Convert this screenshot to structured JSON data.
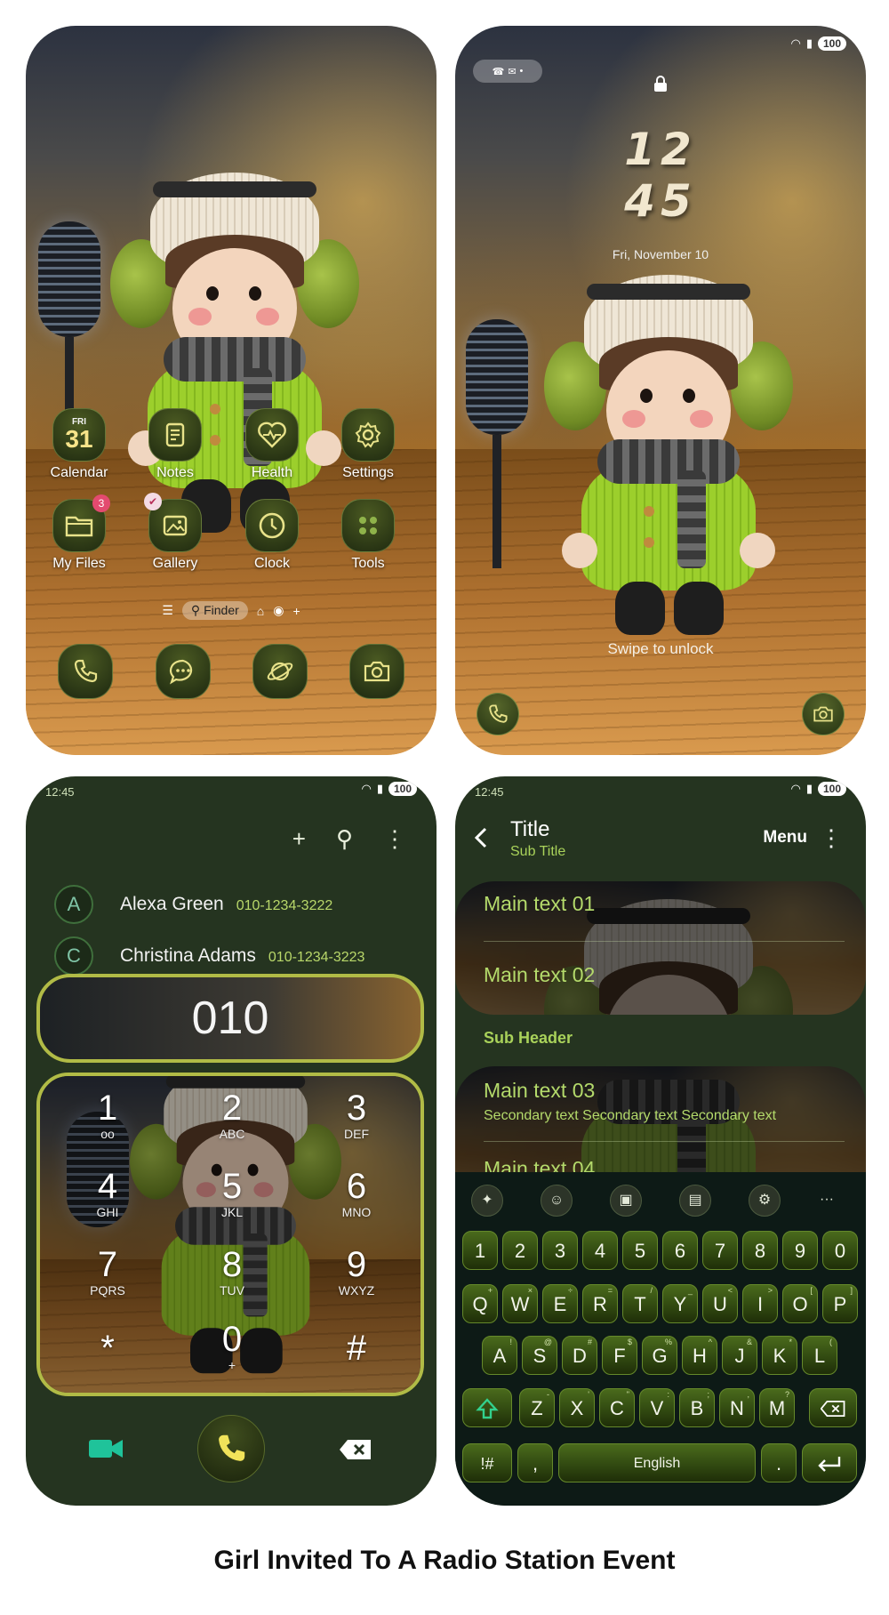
{
  "home": {
    "apps": [
      {
        "label": "Calendar",
        "icon": "calendar-icon",
        "day": "FRI",
        "date": "31"
      },
      {
        "label": "Notes",
        "icon": "notes-icon"
      },
      {
        "label": "Health",
        "icon": "health-icon"
      },
      {
        "label": "Settings",
        "icon": "gear-icon"
      },
      {
        "label": "My Files",
        "icon": "folder-icon",
        "badge": "3"
      },
      {
        "label": "Gallery",
        "icon": "gallery-icon"
      },
      {
        "label": "Clock",
        "icon": "clock-icon"
      },
      {
        "label": "Tools",
        "icon": "tools-icon"
      }
    ],
    "finder": {
      "label": "Finder"
    },
    "dock": [
      {
        "icon": "phone-icon"
      },
      {
        "icon": "messages-icon"
      },
      {
        "icon": "internet-icon"
      },
      {
        "icon": "camera-icon"
      }
    ]
  },
  "lock": {
    "battery": "100",
    "time_hours": "12",
    "time_minutes": "45",
    "date": "Fri, November 10",
    "swipe_text": "Swipe to unlock"
  },
  "dialer": {
    "status_time": "12:45",
    "battery": "100",
    "contacts": [
      {
        "initial": "A",
        "name": "Alexa Green",
        "number": "010-1234-3222"
      },
      {
        "initial": "C",
        "name": "Christina Adams",
        "number": "010-1234-3223"
      }
    ],
    "entered": "010",
    "keys": [
      {
        "digit": "1",
        "sub": "ᴏᴏ"
      },
      {
        "digit": "2",
        "sub": "ABC"
      },
      {
        "digit": "3",
        "sub": "DEF"
      },
      {
        "digit": "4",
        "sub": "GHI"
      },
      {
        "digit": "5",
        "sub": "JKL"
      },
      {
        "digit": "6",
        "sub": "MNO"
      },
      {
        "digit": "7",
        "sub": "PQRS"
      },
      {
        "digit": "8",
        "sub": "TUV"
      },
      {
        "digit": "9",
        "sub": "WXYZ"
      },
      {
        "digit": "*",
        "sub": ""
      },
      {
        "digit": "0",
        "sub": "+"
      },
      {
        "digit": "#",
        "sub": ""
      }
    ],
    "colors": {
      "accent": "#b1bb46",
      "video": "#1fc39a",
      "background": "#253420"
    }
  },
  "settings": {
    "status_time": "12:45",
    "battery": "100",
    "title": "Title",
    "subtitle": "Sub Title",
    "menu": "Menu",
    "items": [
      {
        "main": "Main text 01"
      },
      {
        "main": "Main text 02"
      },
      {
        "main": "Main text 03",
        "secondary": "Secondary text Secondary text Secondary text"
      },
      {
        "main": "Main text 04"
      }
    ],
    "sub_header": "Sub Header"
  },
  "keyboard": {
    "row_numbers": [
      "1",
      "2",
      "3",
      "4",
      "5",
      "6",
      "7",
      "8",
      "9",
      "0"
    ],
    "row_q": [
      "Q",
      "W",
      "E",
      "R",
      "T",
      "Y",
      "U",
      "I",
      "O",
      "P"
    ],
    "row_q_hints": [
      "+",
      "×",
      "÷",
      "=",
      "/",
      "_",
      "<",
      ">",
      "[",
      "]"
    ],
    "row_a": [
      "A",
      "S",
      "D",
      "F",
      "G",
      "H",
      "J",
      "K",
      "L"
    ],
    "row_a_hints": [
      "!",
      "@",
      "#",
      "$",
      "%",
      "^",
      "&",
      "*",
      "("
    ],
    "row_z": [
      "Z",
      "X",
      "C",
      "V",
      "B",
      "N",
      "M"
    ],
    "row_z_hints": [
      "-",
      "'",
      "\"",
      ":",
      ";",
      ",",
      "?"
    ],
    "symbols_key": "!#",
    "comma_key": ",",
    "space_label": "English",
    "period_key": ".",
    "more_tools": "···"
  },
  "caption": "Girl Invited To A Radio Station Event"
}
